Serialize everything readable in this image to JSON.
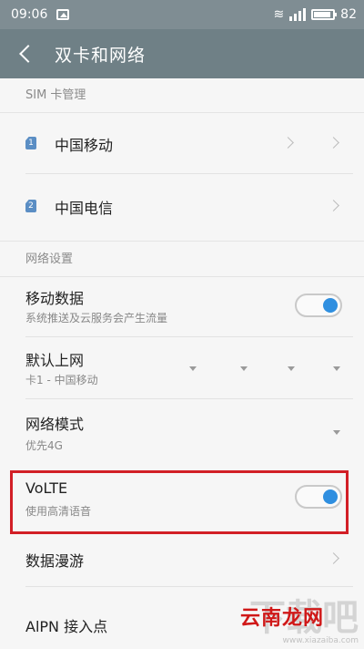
{
  "statusbar": {
    "time": "09:06",
    "battery": "82"
  },
  "header": {
    "title": "双卡和网络"
  },
  "sim_section": {
    "header": "SIM 卡管理",
    "items": [
      {
        "badge": "1",
        "label": "中国移动"
      },
      {
        "badge": "2",
        "label": "中国电信"
      }
    ]
  },
  "network_section": {
    "header": "网络设置",
    "mobile_data": {
      "title": "移动数据",
      "subtitle": "系统推送及云服务会产生流量",
      "enabled": true
    },
    "default_internet": {
      "title": "默认上网",
      "subtitle": "卡1 - 中国移动"
    },
    "network_mode": {
      "title": "网络模式",
      "subtitle": "优先4G"
    },
    "volte": {
      "title": "VoLTE",
      "subtitle": "使用高清语音",
      "enabled": true
    },
    "roaming": {
      "title": "数据漫游"
    },
    "apn": {
      "title": "AlPN 接入点"
    }
  },
  "watermark": {
    "brand": "云南龙网",
    "big": "下载吧",
    "url": "www.xiazaiba.com"
  },
  "colors": {
    "titlebar": "#6f8086",
    "accent": "#2f8fe0",
    "highlight": "#d21f26"
  }
}
